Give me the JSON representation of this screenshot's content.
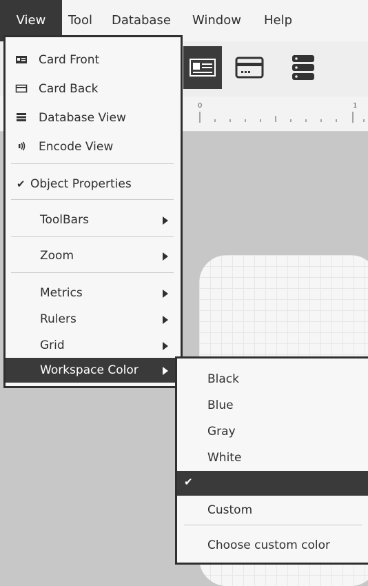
{
  "menubar": {
    "items": [
      "View",
      "Tool",
      "Database",
      "Window",
      "Help"
    ],
    "active_index": 0
  },
  "toolbar": {
    "buttons": [
      "card-front-view-icon",
      "card-back-view-icon",
      "database-view-icon"
    ],
    "selected": "card-front-view-icon"
  },
  "ruler": {
    "labels": [
      "0",
      "1"
    ]
  },
  "view_menu": {
    "items": [
      {
        "label": "Card Front",
        "icon": "card-front-icon"
      },
      {
        "label": "Card Back",
        "icon": "card-back-icon"
      },
      {
        "label": "Database View",
        "icon": "database-icon"
      },
      {
        "label": "Encode View",
        "icon": "encode-icon"
      },
      {
        "label": "Object Properties",
        "checked": true
      },
      {
        "label": "ToolBars",
        "submenu": true
      },
      {
        "label": "Zoom",
        "submenu": true
      },
      {
        "label": "Metrics",
        "submenu": true
      },
      {
        "label": "Rulers",
        "submenu": true
      },
      {
        "label": "Grid",
        "submenu": true
      },
      {
        "label": "Workspace Color",
        "submenu": true,
        "highlighted": true
      }
    ]
  },
  "workspace_color_menu": {
    "items": [
      {
        "label": "Black"
      },
      {
        "label": "Blue"
      },
      {
        "label": "Gray"
      },
      {
        "label": "White"
      },
      {
        "label": "",
        "checked": true,
        "highlighted": true
      },
      {
        "label": "Custom"
      },
      {
        "label": "Choose custom color"
      }
    ]
  },
  "colors": {
    "menu_highlight": "#3a3a3a",
    "workspace": "#c7c7c7",
    "menu_bg": "#f7f7f7"
  }
}
